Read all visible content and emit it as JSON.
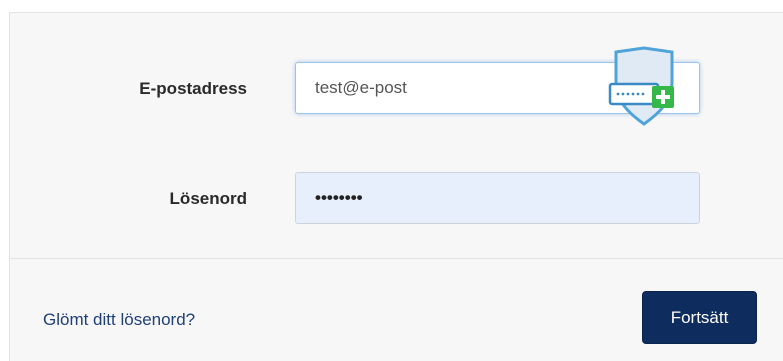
{
  "form": {
    "email_label": "E-postadress",
    "email_value": "test@e-post",
    "password_label": "Lösenord",
    "password_value": "••••••••"
  },
  "footer": {
    "forgot_link": "Glömt ditt lösenord?",
    "continue_label": "Fortsätt"
  },
  "icons": {
    "password_manager": "password-manager-shield-icon"
  },
  "colors": {
    "button_bg": "#0e2d5e",
    "link": "#1f3f77",
    "password_bg": "#e8effc",
    "shield": "#4fa3d9",
    "plus_badge": "#35b84a"
  }
}
